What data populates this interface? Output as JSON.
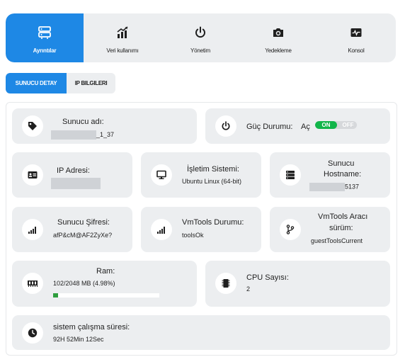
{
  "tabs": [
    {
      "label": "Ayrıntılar",
      "icon": "server-icon",
      "active": true
    },
    {
      "label": "Veri kullanımı",
      "icon": "chart-icon",
      "active": false
    },
    {
      "label": "Yönetim",
      "icon": "power-icon",
      "active": false
    },
    {
      "label": "Yedekleme",
      "icon": "camera-icon",
      "active": false
    },
    {
      "label": "Konsol",
      "icon": "console-icon",
      "active": false
    }
  ],
  "subtabs": [
    {
      "label": "SUNUCU DETAY",
      "active": true
    },
    {
      "label": "IP BILGILERI",
      "active": false
    }
  ],
  "server_name": {
    "title": "Sunucu adı:",
    "value_suffix": "_1_37"
  },
  "power": {
    "title": "Güç Durumu:",
    "state": "Aç",
    "toggle_on": "ON",
    "toggle_off": "OFF"
  },
  "ip": {
    "title": "IP Adresi:"
  },
  "os": {
    "title": "İşletim Sistemi:",
    "value": "Ubuntu Linux (64-bit)"
  },
  "hostname": {
    "title_line1": "Sunucu",
    "title_line2": "Hostname:",
    "value_suffix": "5137"
  },
  "password": {
    "title": "Sunucu Şifresi:",
    "value": "afP&cM@AF2ZyXe?"
  },
  "vmtools_status": {
    "title": "VmTools Durumu:",
    "value": "toolsOk"
  },
  "vmtools_version": {
    "title_line1": "VmTools Aracı",
    "title_line2": "sürüm:",
    "value": "guestToolsCurrent"
  },
  "ram": {
    "title": "Ram:",
    "value": "102/2048 MB (4.98%)",
    "percent": 4.98
  },
  "cpu": {
    "title": "CPU Sayısı:",
    "value": "2"
  },
  "uptime": {
    "title": "sistem çalışma süresi:",
    "value": "92H 52Min 12Sec"
  },
  "colors": {
    "accent": "#1e88e5",
    "toggle_on": "#12b54a",
    "progress": "#2e9e3e",
    "card_bg": "#eceef0"
  }
}
